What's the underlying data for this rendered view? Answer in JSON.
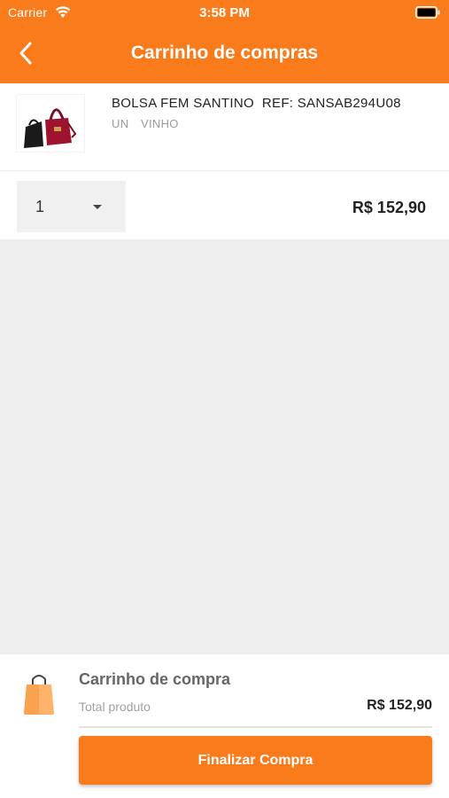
{
  "status_bar": {
    "carrier": "Carrier",
    "time": "3:58 PM",
    "wifi_icon": "wifi-icon",
    "battery_icon": "battery-icon"
  },
  "nav": {
    "title": "Carrinho de compras",
    "back_icon": "chevron-left-icon",
    "color": "#fa7b1c"
  },
  "cart": {
    "items": [
      {
        "name": "BOLSA FEM SANTINO  REF: SANSAB294U08",
        "unit": "UN",
        "color": "VINHO",
        "quantity": "1",
        "price": "R$ 152,90",
        "thumbnail_icon": "handbag-image"
      }
    ]
  },
  "summary": {
    "title": "Carrinho de compra",
    "total_label": "Total produto",
    "total_value": "R$ 152,90",
    "icon": "shopping-bag-icon",
    "checkout_label": "Finalizar Compra"
  }
}
